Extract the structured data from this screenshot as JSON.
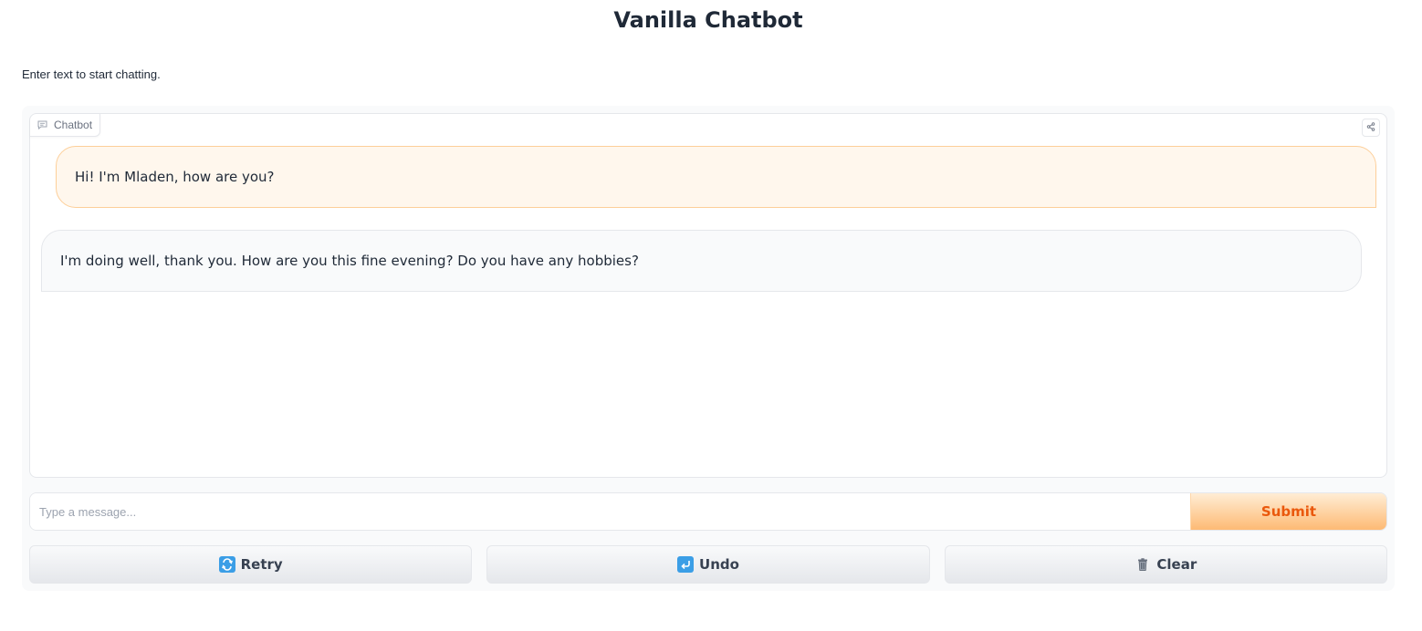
{
  "page": {
    "title": "Vanilla Chatbot",
    "description": "Enter text to start chatting."
  },
  "chatbot": {
    "label": "Chatbot",
    "icons": {
      "label_icon": "chat-icon",
      "share_icon": "share-icon"
    },
    "messages": [
      {
        "role": "user",
        "text": "Hi! I'm Mladen, how are you?"
      },
      {
        "role": "bot",
        "text": "I'm doing well, thank you. How are you this fine evening? Do you have any hobbies?"
      }
    ]
  },
  "input": {
    "placeholder": "Type a message...",
    "value": "",
    "submit_label": "Submit"
  },
  "buttons": {
    "retry": {
      "label": "Retry",
      "icon": "retry-icon"
    },
    "undo": {
      "label": "Undo",
      "icon": "undo-icon"
    },
    "clear": {
      "label": "Clear",
      "icon": "trash-icon"
    }
  },
  "colors": {
    "accent": "#ea580c",
    "user_bubble_bg": "#fff7ed",
    "user_bubble_border": "#fdcf99",
    "bot_bubble_bg": "#f9fafb"
  }
}
